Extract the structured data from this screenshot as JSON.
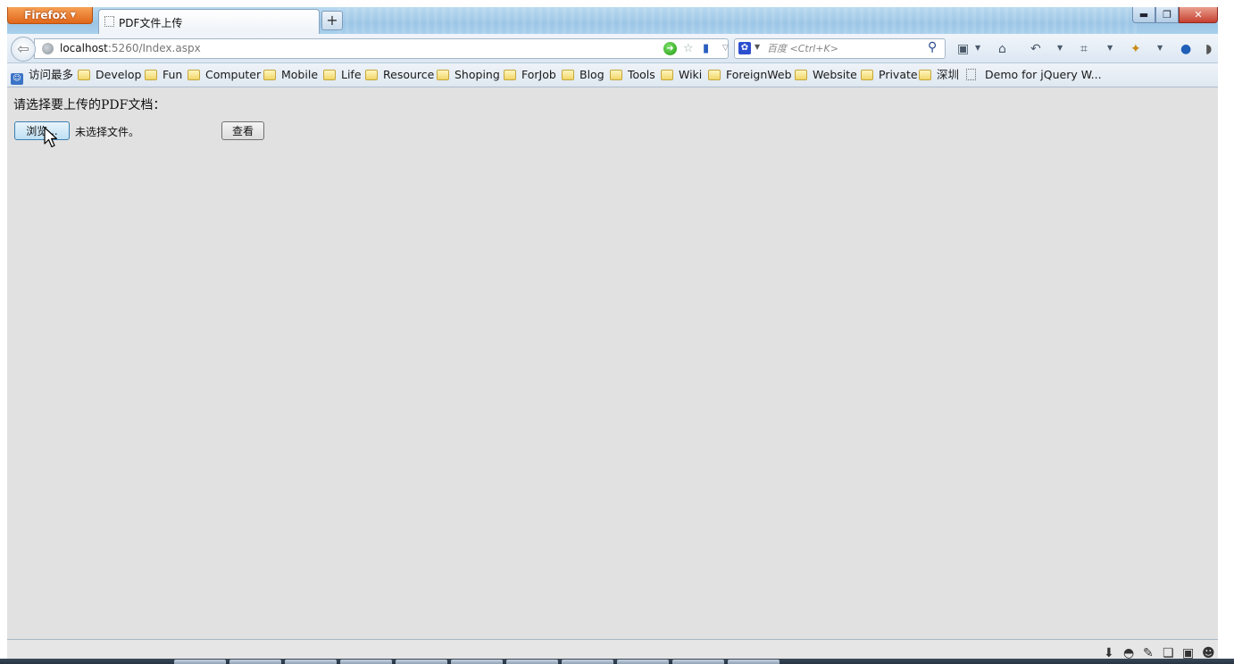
{
  "browser": {
    "menu_button": "Firefox",
    "tab_title": "PDF文件上传",
    "new_tab": "+",
    "window_controls": {
      "minimize": "▬",
      "maximize": "❐",
      "close": "✕"
    }
  },
  "navbar": {
    "url_host": "localhost",
    "url_rest": ":5260/Index.aspx",
    "search_placeholder": "百度 <Ctrl+K>",
    "icons": [
      "back-icon",
      "globe-icon",
      "go-icon",
      "star-icon",
      "mobile-icon",
      "dropdown-icon",
      "reload-icon",
      "search-engine-icon",
      "search-icon",
      "bookmarks-icon",
      "home-icon",
      "undo-icon",
      "crop-icon",
      "addon-icon",
      "sync-icon"
    ]
  },
  "bookmarks": [
    {
      "label": "访问最多",
      "kind": "mostvisited"
    },
    {
      "label": "Develop",
      "kind": "folder"
    },
    {
      "label": "Fun",
      "kind": "folder"
    },
    {
      "label": "Computer",
      "kind": "folder"
    },
    {
      "label": "Mobile",
      "kind": "folder"
    },
    {
      "label": "Life",
      "kind": "folder"
    },
    {
      "label": "Resource",
      "kind": "folder"
    },
    {
      "label": "Shoping",
      "kind": "folder"
    },
    {
      "label": "ForJob",
      "kind": "folder"
    },
    {
      "label": "Blog",
      "kind": "folder"
    },
    {
      "label": "Tools",
      "kind": "folder"
    },
    {
      "label": "Wiki",
      "kind": "folder"
    },
    {
      "label": "ForeignWeb",
      "kind": "folder"
    },
    {
      "label": "Website",
      "kind": "folder"
    },
    {
      "label": "Private",
      "kind": "folder"
    },
    {
      "label": "深圳",
      "kind": "folder"
    },
    {
      "label": "Demo for jQuery W...",
      "kind": "page"
    }
  ],
  "page": {
    "prompt": "请选择要上传的PDF文档：",
    "browse_label": "浏览...",
    "file_status": "未选择文件。",
    "view_label": "查看"
  },
  "addon_bar": {
    "icons": [
      "download-icon",
      "mask-icon",
      "brush-icon",
      "windows-icon",
      "box-icon",
      "user-icon"
    ]
  }
}
